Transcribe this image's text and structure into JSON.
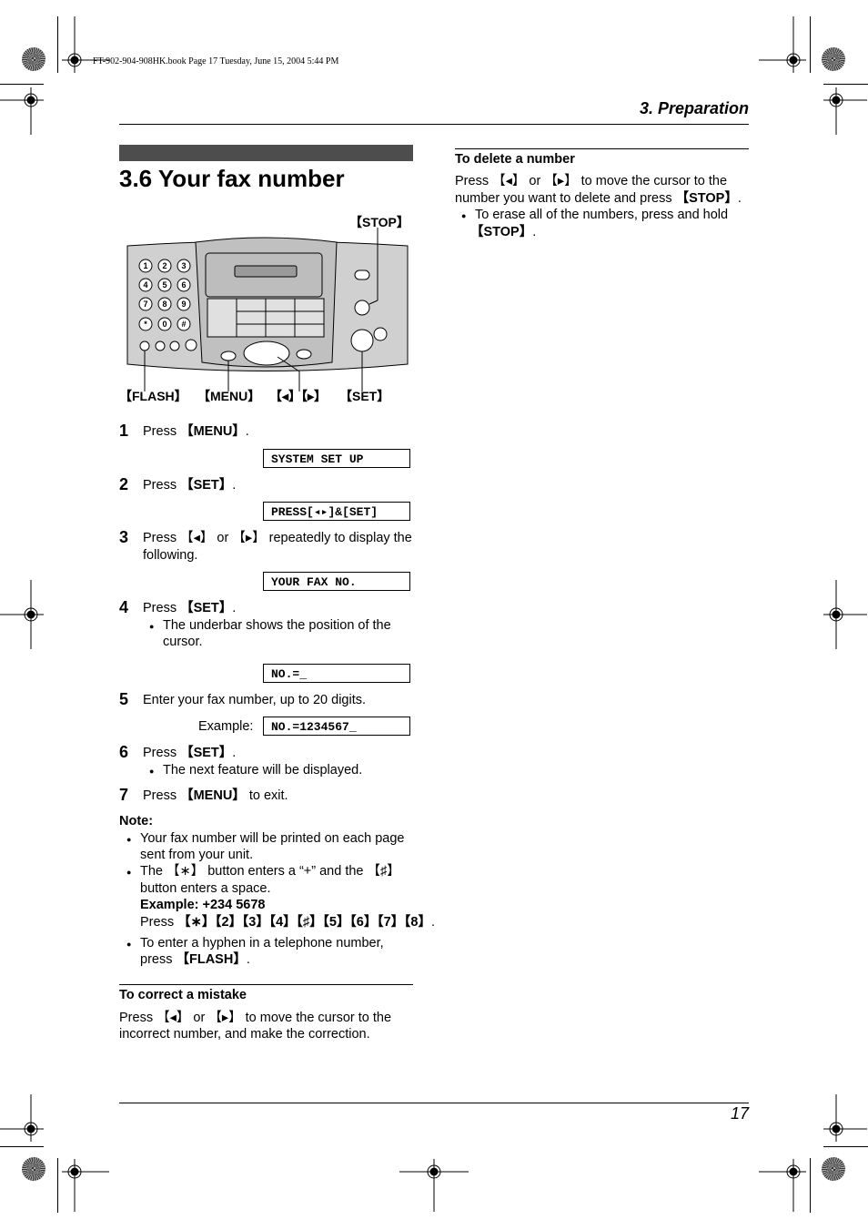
{
  "header": {
    "book_line": "FT-902-904-908HK.book  Page 17  Tuesday, June 15, 2004  5:44 PM",
    "section": "3. Preparation"
  },
  "title": "3.6 Your fax number",
  "diagram": {
    "labels": {
      "stop": "【STOP】",
      "flash": "【FLASH】",
      "menu": "【MENU】",
      "arrows": "【◂】【▸】",
      "set": "【SET】"
    },
    "keypad": [
      "1",
      "2",
      "3",
      "4",
      "5",
      "6",
      "7",
      "8",
      "9",
      "*",
      "0",
      "#"
    ]
  },
  "steps": [
    {
      "num": "1",
      "pre": "Press ",
      "key": "【MENU】",
      "post": ".",
      "display": "SYSTEM SET UP"
    },
    {
      "num": "2",
      "pre": "Press ",
      "key": "【SET】",
      "post": ".",
      "display": "PRESS[◂▸]&[SET]"
    },
    {
      "num": "3",
      "line1": "Press 【◂】 or 【▸】 repeatedly to display the",
      "line2": "following.",
      "display": "YOUR FAX NO."
    },
    {
      "num": "4",
      "pre": "Press ",
      "key": "【SET】",
      "post": ".",
      "bullet": "The underbar shows the position of the",
      "bullet2": "cursor.",
      "display": "NO.=_"
    },
    {
      "num": "5",
      "text": "Enter your fax number, up to 20 digits.",
      "example_label": "Example:",
      "display": "NO.=1234567_"
    },
    {
      "num": "6",
      "pre": "Press ",
      "key": "【SET】",
      "post": ".",
      "bullet": "The next feature will be displayed."
    },
    {
      "num": "7",
      "pre": "Press ",
      "key": "【MENU】",
      "post": " to exit."
    }
  ],
  "note": {
    "heading": "Note:",
    "b1_l1": "Your fax number will be printed on each page",
    "b1_l2": "sent from your unit.",
    "b2_l1": "The 【∗】 button enters a “+” and the 【♯】",
    "b2_l2": "button enters a space.",
    "b2_example": "Example: +234 5678",
    "b2_press": "Press ",
    "b2_keys": "【∗】【2】【3】【4】【♯】【5】【6】【7】【8】",
    "b3_l1": "To enter a hyphen in a telephone number,",
    "b3_pre": "press ",
    "b3_key": "【FLASH】"
  },
  "correct": {
    "heading": "To correct a mistake",
    "l1": "Press 【◂】 or 【▸】 to move the cursor to the",
    "l2": "incorrect number, and make the correction."
  },
  "delete": {
    "heading": "To delete a number",
    "l1": "Press 【◂】 or 【▸】 to move the cursor to the",
    "l2_pre": "number you want to delete and press ",
    "l2_key": "【STOP】",
    "bullet_l1": "To erase all of the numbers, press and hold",
    "bullet_key": "【STOP】"
  },
  "footer": {
    "page": "17"
  }
}
